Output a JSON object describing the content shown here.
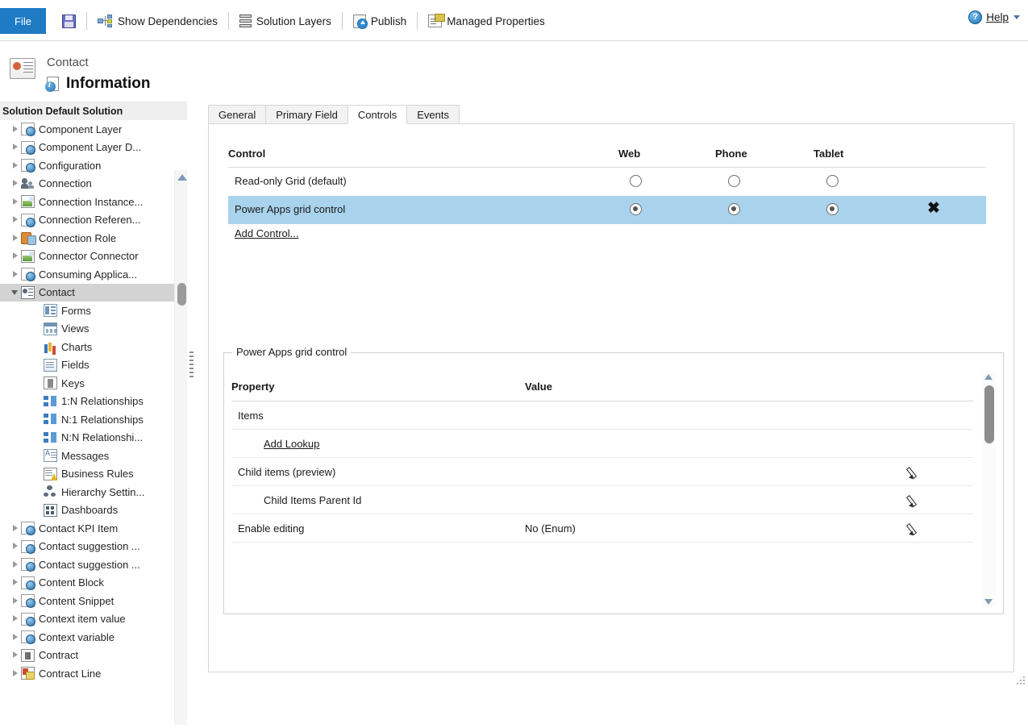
{
  "toolbar": {
    "file_label": "File",
    "items": [
      {
        "label": "",
        "icon": "save-icon"
      },
      {
        "label": "Show Dependencies",
        "icon": "dependencies-icon"
      },
      {
        "label": "Solution Layers",
        "icon": "solution-layers-icon"
      },
      {
        "label": "Publish",
        "icon": "publish-icon"
      },
      {
        "label": "Managed Properties",
        "icon": "managed-properties-icon"
      }
    ],
    "help_label": "Help",
    "help_icon": "help-icon"
  },
  "entity_header": {
    "entity_name": "Contact",
    "page_title": "Information",
    "solution_bar": "Solution Default Solution"
  },
  "tree": {
    "items": [
      {
        "label": "Component Layer",
        "indent": 0,
        "twisty": "collapsed",
        "icon": "ic-gear"
      },
      {
        "label": "Component Layer D...",
        "indent": 0,
        "twisty": "collapsed",
        "icon": "ic-gear"
      },
      {
        "label": "Configuration",
        "indent": 0,
        "twisty": "collapsed",
        "icon": "ic-gear"
      },
      {
        "label": "Connection",
        "indent": 0,
        "twisty": "collapsed",
        "icon": "ic-people"
      },
      {
        "label": "Connection Instance...",
        "indent": 0,
        "twisty": "collapsed",
        "icon": "ic-image"
      },
      {
        "label": "Connection Referen...",
        "indent": 0,
        "twisty": "collapsed",
        "icon": "ic-gear"
      },
      {
        "label": "Connection Role",
        "indent": 0,
        "twisty": "collapsed",
        "icon": "ic-role"
      },
      {
        "label": "Connector Connector",
        "indent": 0,
        "twisty": "collapsed",
        "icon": "ic-image"
      },
      {
        "label": "Consuming Applica...",
        "indent": 0,
        "twisty": "collapsed",
        "icon": "ic-gear"
      },
      {
        "label": "Contact",
        "indent": 0,
        "twisty": "expanded",
        "icon": "ic-contactmain",
        "selected": true
      },
      {
        "label": "Forms",
        "indent": 1,
        "twisty": "none",
        "icon": "ic-form"
      },
      {
        "label": "Views",
        "indent": 1,
        "twisty": "none",
        "icon": "ic-view"
      },
      {
        "label": "Charts",
        "indent": 1,
        "twisty": "none",
        "icon": "ic-chart"
      },
      {
        "label": "Fields",
        "indent": 1,
        "twisty": "none",
        "icon": "ic-field"
      },
      {
        "label": "Keys",
        "indent": 1,
        "twisty": "none",
        "icon": "ic-key"
      },
      {
        "label": "1:N Relationships",
        "indent": 1,
        "twisty": "none",
        "icon": "ic-rel"
      },
      {
        "label": "N:1 Relationships",
        "indent": 1,
        "twisty": "none",
        "icon": "ic-rel"
      },
      {
        "label": "N:N Relationshi...",
        "indent": 1,
        "twisty": "none",
        "icon": "ic-rel"
      },
      {
        "label": "Messages",
        "indent": 1,
        "twisty": "none",
        "icon": "ic-msg"
      },
      {
        "label": "Business Rules",
        "indent": 1,
        "twisty": "none",
        "icon": "ic-rule"
      },
      {
        "label": "Hierarchy Settin...",
        "indent": 1,
        "twisty": "none",
        "icon": "ic-hier"
      },
      {
        "label": "Dashboards",
        "indent": 1,
        "twisty": "none",
        "icon": "ic-dash"
      },
      {
        "label": "Contact KPI Item",
        "indent": 0,
        "twisty": "collapsed",
        "icon": "ic-gear"
      },
      {
        "label": "Contact suggestion ...",
        "indent": 0,
        "twisty": "collapsed",
        "icon": "ic-gear"
      },
      {
        "label": "Contact suggestion ...",
        "indent": 0,
        "twisty": "collapsed",
        "icon": "ic-gear"
      },
      {
        "label": "Content Block",
        "indent": 0,
        "twisty": "collapsed",
        "icon": "ic-gear"
      },
      {
        "label": "Content Snippet",
        "indent": 0,
        "twisty": "collapsed",
        "icon": "ic-gear"
      },
      {
        "label": "Context item value",
        "indent": 0,
        "twisty": "collapsed",
        "icon": "ic-gear"
      },
      {
        "label": "Context variable",
        "indent": 0,
        "twisty": "collapsed",
        "icon": "ic-gear"
      },
      {
        "label": "Contract",
        "indent": 0,
        "twisty": "collapsed",
        "icon": "ic-contract"
      },
      {
        "label": "Contract Line",
        "indent": 0,
        "twisty": "collapsed",
        "icon": "ic-contractline"
      }
    ]
  },
  "tabs": [
    {
      "label": "General",
      "active": false
    },
    {
      "label": "Primary Field",
      "active": false
    },
    {
      "label": "Controls",
      "active": true
    },
    {
      "label": "Events",
      "active": false
    }
  ],
  "control_grid": {
    "headers": {
      "control": "Control",
      "web": "Web",
      "phone": "Phone",
      "tablet": "Tablet"
    },
    "rows": [
      {
        "name": "Read-only Grid (default)",
        "web": false,
        "phone": false,
        "tablet": false,
        "selected": false,
        "deletable": false
      },
      {
        "name": "Power Apps grid control",
        "web": true,
        "phone": true,
        "tablet": true,
        "selected": true,
        "deletable": true
      }
    ],
    "add_control_label": "Add Control...",
    "delete_icon": "delete-x-icon",
    "selected_row_color": "#a9d2ec"
  },
  "property_panel": {
    "legend": "Power Apps grid control",
    "headers": {
      "property": "Property",
      "value": "Value"
    },
    "rows": [
      {
        "name": "Items",
        "value": "",
        "indent": 0,
        "type": "text",
        "edit": false
      },
      {
        "name": "Add Lookup",
        "value": "",
        "indent": 1,
        "type": "link",
        "edit": false
      },
      {
        "name": "Child items (preview)",
        "value": "",
        "indent": 0,
        "type": "text",
        "edit": true
      },
      {
        "name": "Child Items Parent Id",
        "value": "",
        "indent": 1,
        "type": "text",
        "edit": true
      },
      {
        "name": "Enable editing",
        "value": "No (Enum)",
        "indent": 0,
        "type": "text",
        "edit": true
      }
    ],
    "edit_icon": "pencil-icon"
  },
  "colors": {
    "accent_blue": "#1e7bc4",
    "selected_row": "#a9d2ec",
    "tree_selected": "#d3d3d3",
    "border": "#d6d6d6"
  }
}
